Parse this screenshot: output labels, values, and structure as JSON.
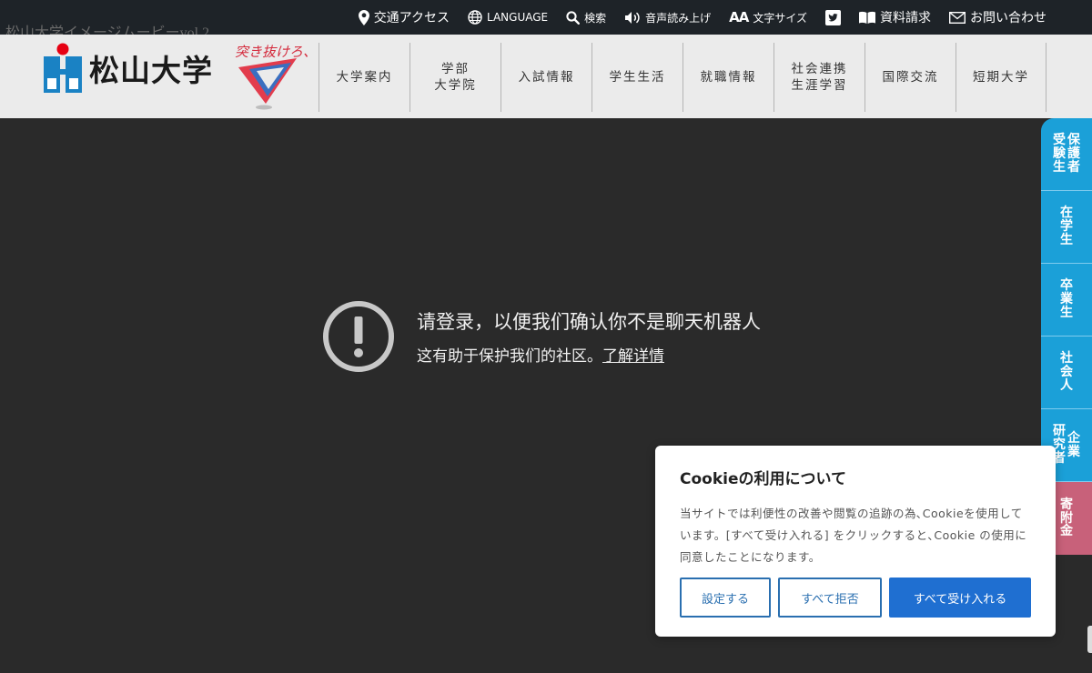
{
  "ghost_title": "松山大学イメージムービーvol.2",
  "top_links": [
    {
      "label": "交通アクセス",
      "icon": "location-pin-icon"
    },
    {
      "label": "LANGUAGE",
      "icon": "globe-icon"
    },
    {
      "label": "検索",
      "icon": "search-icon"
    },
    {
      "label": "音声読み上げ",
      "icon": "speaker-icon"
    },
    {
      "label": "文字サイズ",
      "icon": "font-size-icon",
      "icon_text": "AA"
    },
    {
      "label": "",
      "icon": "twitter-icon"
    },
    {
      "label": "資料請求",
      "icon": "book-icon"
    },
    {
      "label": "お問い合わせ",
      "icon": "mail-icon"
    }
  ],
  "logo": {
    "name": "松山大学",
    "slogan": "突き抜けろ、ミライ。"
  },
  "main_nav": [
    "大学案内",
    "学部\n大学院",
    "入試情報",
    "学生生活",
    "就職情報",
    "社会連携\n生涯学習",
    "国際交流",
    "短期大学"
  ],
  "message": {
    "title": "请登录，以便我们确认你不是聊天机器人",
    "subtitle": "这有助于保护我们的社区。",
    "link": "了解详情"
  },
  "side_tabs": [
    {
      "cols": [
        "保護者",
        "受験生"
      ],
      "color": "#1ba0d8"
    },
    {
      "cols": [
        "在学生"
      ],
      "color": "#1ba0d8"
    },
    {
      "cols": [
        "卒業生"
      ],
      "color": "#1ba0d8"
    },
    {
      "cols": [
        "社会人"
      ],
      "color": "#1ba0d8"
    },
    {
      "cols": [
        "企業",
        "研究者"
      ],
      "color": "#1ba0d8"
    },
    {
      "cols": [
        "寄附金"
      ],
      "color": "#c8617a"
    }
  ],
  "cookie": {
    "title": "Cookieの利用について",
    "body": "当サイトでは利便性の改善や閲覧の追跡の為､Cookieを使用しています。[すべて受け入れる] をクリックすると､Cookie の使用に同意したことになります。",
    "btn_settings": "設定する",
    "btn_reject": "すべて拒否",
    "btn_accept": "すべて受け入れる"
  },
  "colors": {
    "topbar": "#1e2328",
    "header": "#ebebeb",
    "page": "#2a2a2a",
    "side_tab": "#1ba0d8",
    "side_tab_donation": "#c8617a",
    "accept_button": "#1f6fd1",
    "logo_blue": "#1a82c4",
    "logo_red": "#e60012"
  }
}
